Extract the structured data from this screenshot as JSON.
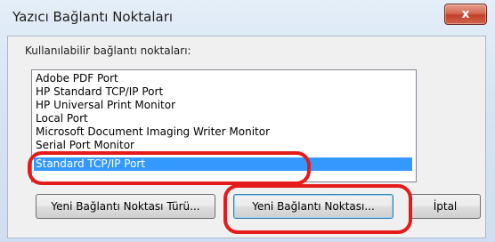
{
  "window": {
    "title": "Yazıcı Bağlantı Noktaları",
    "close_label": "x"
  },
  "list": {
    "label": "Kullanılabilir bağlantı noktaları:",
    "items": [
      {
        "label": "Adobe PDF Port"
      },
      {
        "label": "HP Standard TCP/IP Port"
      },
      {
        "label": "HP Universal Print Monitor"
      },
      {
        "label": "Local Port"
      },
      {
        "label": "Microsoft Document Imaging Writer Monitor"
      },
      {
        "label": "Serial Port Monitor"
      },
      {
        "label": "Standard TCP/IP Port"
      }
    ],
    "selected_index": 6
  },
  "buttons": {
    "new_port_type": "Yeni Bağlantı Noktası Türü...",
    "new_port": "Yeni Bağlantı Noktası...",
    "cancel": "İptal"
  },
  "colors": {
    "selection": "#3399ff",
    "highlight": "#e51b1b",
    "close_button": "#c0402b"
  }
}
